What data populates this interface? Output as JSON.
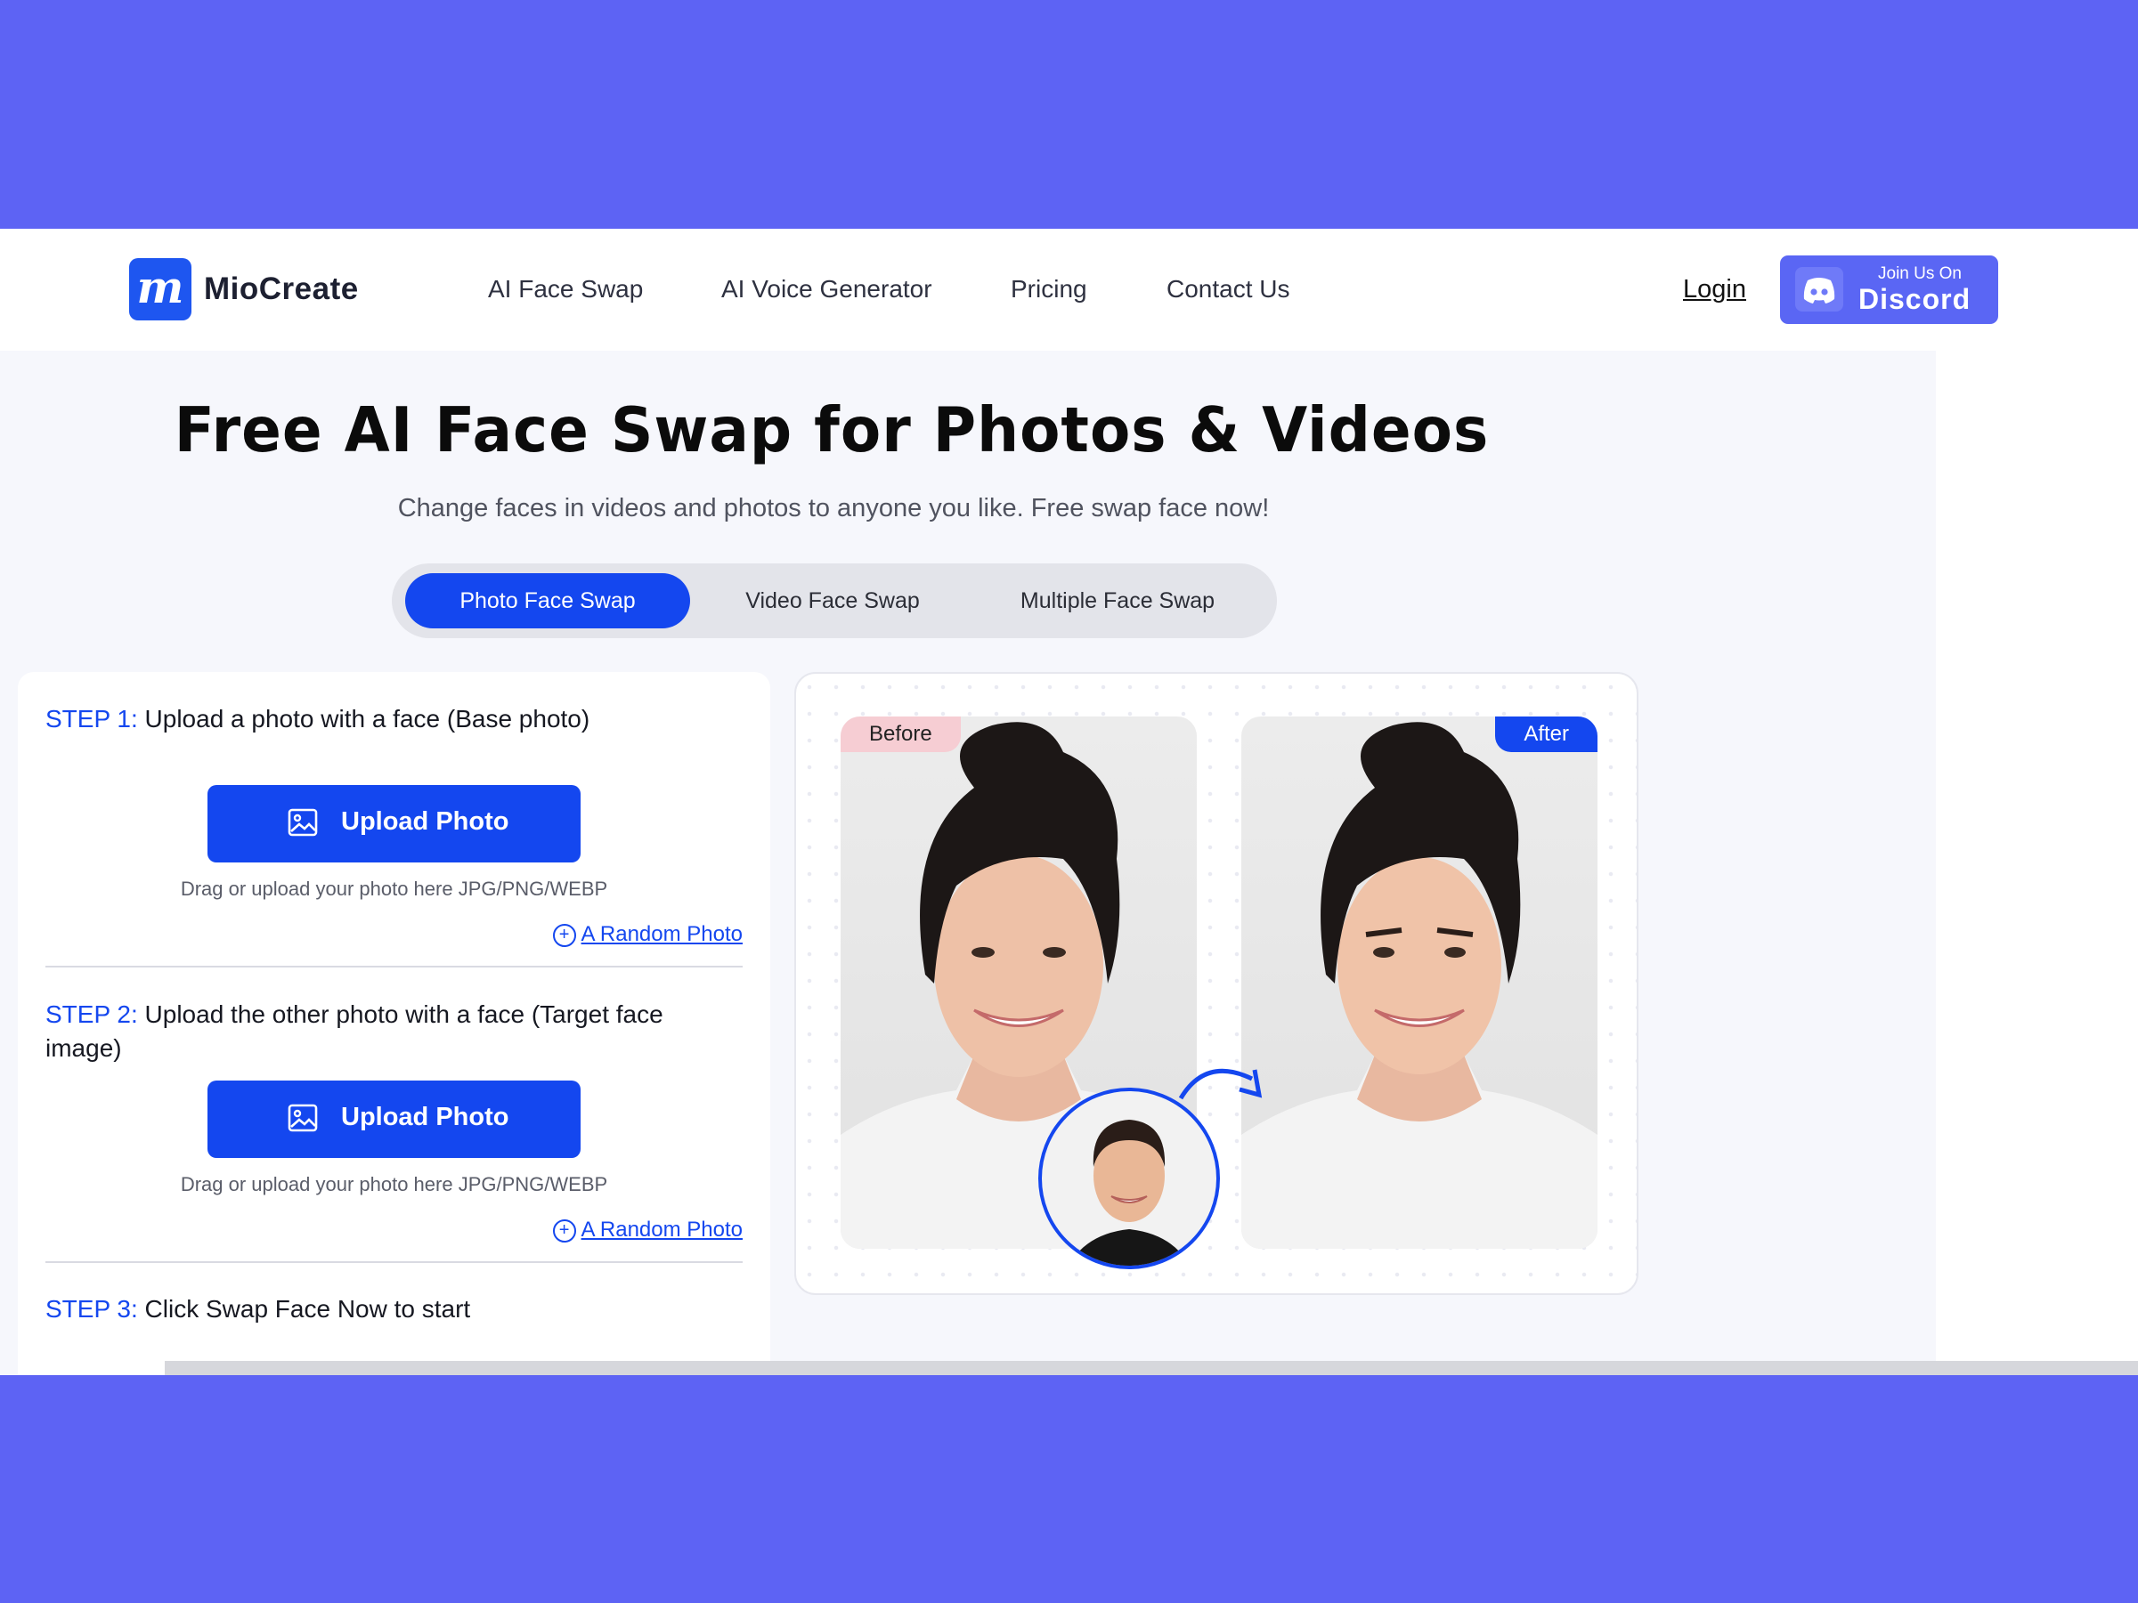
{
  "header": {
    "logo_letter": "m",
    "brand": "MioCreate",
    "nav": [
      "AI Face Swap",
      "AI Voice Generator",
      "Pricing",
      "Contact Us"
    ],
    "login": "Login",
    "discord": {
      "line1": "Join Us On",
      "line2": "Discord"
    }
  },
  "hero": {
    "title": "Free AI Face Swap for Photos & Videos",
    "subtitle": "Change faces in videos and photos to anyone you like. Free swap face now!"
  },
  "tabs": [
    {
      "label": "Photo Face Swap",
      "active": true
    },
    {
      "label": "Video Face Swap",
      "active": false
    },
    {
      "label": "Multiple Face Swap",
      "active": false
    }
  ],
  "steps": {
    "step1": {
      "num": "STEP 1:",
      "text": "Upload a photo with a face (Base photo)"
    },
    "step2": {
      "num": "STEP 2:",
      "text": "Upload the other photo with a face (Target face image)"
    },
    "step3": {
      "num": "STEP 3:",
      "text": "Click Swap Face Now to start"
    },
    "upload_label": "Upload Photo",
    "hint": "Drag or upload your photo here JPG/PNG/WEBP",
    "random": "A Random Photo"
  },
  "preview": {
    "before": "Before",
    "after": "After"
  },
  "colors": {
    "accent": "#1447ef",
    "frame": "#5d63f4",
    "discord": "#5a66f4",
    "before_badge": "#f6cdd3"
  }
}
